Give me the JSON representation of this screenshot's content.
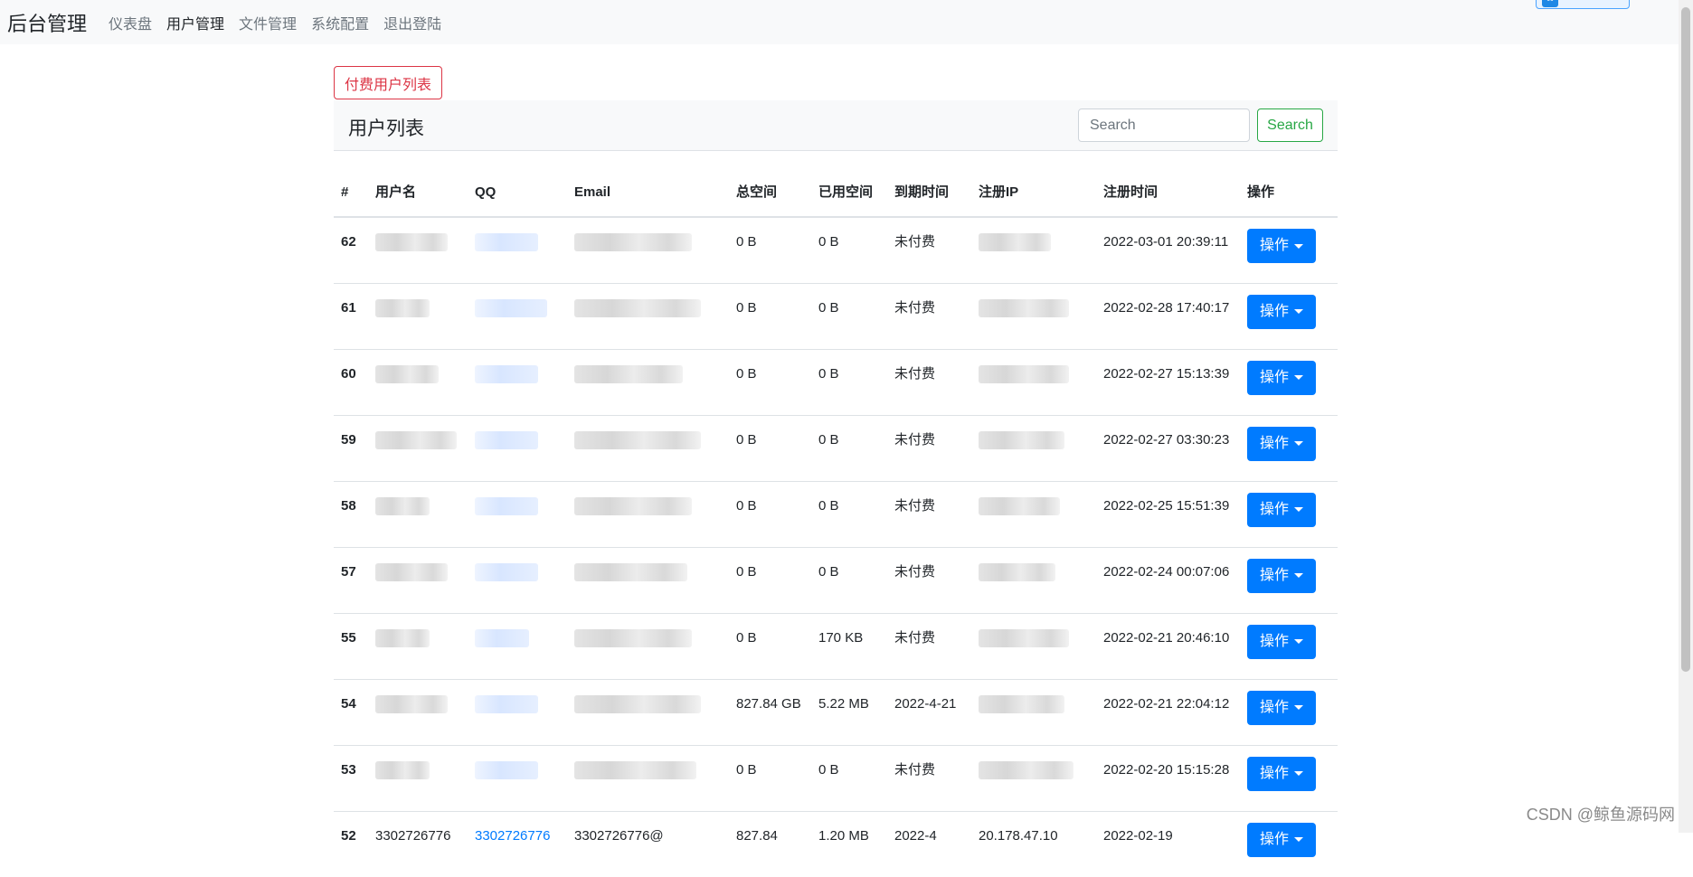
{
  "nav": {
    "brand": "后台管理",
    "items": [
      "仪表盘",
      "用户管理",
      "文件管理",
      "系统配置",
      "退出登陆"
    ],
    "active_index": 1
  },
  "paid_users_button": "付费用户列表",
  "card": {
    "title": "用户列表"
  },
  "search": {
    "placeholder": "Search",
    "button": "Search"
  },
  "table": {
    "headers": [
      "#",
      "用户名",
      "QQ",
      "Email",
      "总空间",
      "已用空间",
      "到期时间",
      "注册IP",
      "注册时间",
      "操作"
    ],
    "rows": [
      {
        "id": "62",
        "username": "",
        "qq": "",
        "email": "",
        "total": "0 B",
        "used": "0 B",
        "expire": "未付费",
        "ip": "",
        "time": "2022-03-01 20:39:11"
      },
      {
        "id": "61",
        "username": "",
        "qq": "",
        "email": "",
        "total": "0 B",
        "used": "0 B",
        "expire": "未付费",
        "ip": "",
        "time": "2022-02-28 17:40:17"
      },
      {
        "id": "60",
        "username": "",
        "qq": "",
        "email": "",
        "total": "0 B",
        "used": "0 B",
        "expire": "未付费",
        "ip": "",
        "time": "2022-02-27 15:13:39"
      },
      {
        "id": "59",
        "username": "",
        "qq": "",
        "email": "",
        "total": "0 B",
        "used": "0 B",
        "expire": "未付费",
        "ip": "",
        "time": "2022-02-27 03:30:23"
      },
      {
        "id": "58",
        "username": "",
        "qq": "",
        "email": "",
        "total": "0 B",
        "used": "0 B",
        "expire": "未付费",
        "ip": "",
        "time": "2022-02-25 15:51:39"
      },
      {
        "id": "57",
        "username": "",
        "qq": "",
        "email": "",
        "total": "0 B",
        "used": "0 B",
        "expire": "未付费",
        "ip": "",
        "time": "2022-02-24 00:07:06"
      },
      {
        "id": "55",
        "username": "",
        "qq": "",
        "email": "",
        "total": "0 B",
        "used": "170 KB",
        "expire": "未付费",
        "ip": "",
        "time": "2022-02-21 20:46:10"
      },
      {
        "id": "54",
        "username": "",
        "qq": "",
        "email": "",
        "total": "827.84 GB",
        "used": "5.22 MB",
        "expire": "2022-4-21",
        "ip": "",
        "time": "2022-02-21 22:04:12"
      },
      {
        "id": "53",
        "username": "",
        "qq": "",
        "email": "",
        "total": "0 B",
        "used": "0 B",
        "expire": "未付费",
        "ip": "",
        "time": "2022-02-20 15:15:28"
      },
      {
        "id": "52",
        "username": "3302726776",
        "qq": "3302726776",
        "email": "3302726776@",
        "total": "827.84",
        "used": "1.20 MB",
        "expire": "2022-4",
        "ip": "20.178.47.10",
        "time": "2022-02-19"
      }
    ],
    "action_label": "操作"
  },
  "watermark": "CSDN @鲸鱼源码网"
}
